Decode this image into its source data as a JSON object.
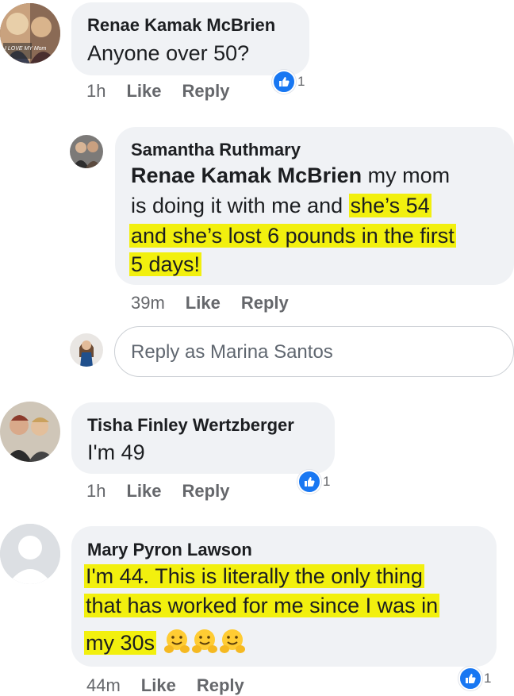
{
  "comments": [
    {
      "author": "Renae Kamak McBrien",
      "avatar_caption": "I LOVE MY Mom",
      "text": "Anyone over 50?",
      "time": "1h",
      "like": "Like",
      "reply": "Reply",
      "reaction_count": "1"
    },
    {
      "author": "Samantha Ruthmary",
      "mention": "Renae Kamak McBrien",
      "line1_plain": " my mom",
      "line2_plain": "is doing it with me and ",
      "line2_hl": "she’s 54",
      "line3_hl": "and she’s lost 6 pounds in the first",
      "line4_hl": "5 days!",
      "time": "39m",
      "like": "Like",
      "reply": "Reply"
    },
    {
      "author": "Tisha Finley Wertzberger",
      "text": "I'm 49",
      "time": "1h",
      "like": "Like",
      "reply": "Reply",
      "reaction_count": "1"
    },
    {
      "author": "Mary Pyron Lawson",
      "line1": "I'm 44. This is literally the only thing",
      "line2": "that has worked for me since I was in",
      "line3": "my 30s",
      "emoji": "hugging-face",
      "time": "44m",
      "like": "Like",
      "reply": "Reply",
      "reaction_count": "1"
    }
  ],
  "reply_box": {
    "placeholder": "Reply as Marina Santos"
  },
  "colors": {
    "bubble": "#f0f2f5",
    "highlight": "#f2f00e",
    "like_blue": "#1877f2",
    "meta_gray": "#65676b"
  }
}
